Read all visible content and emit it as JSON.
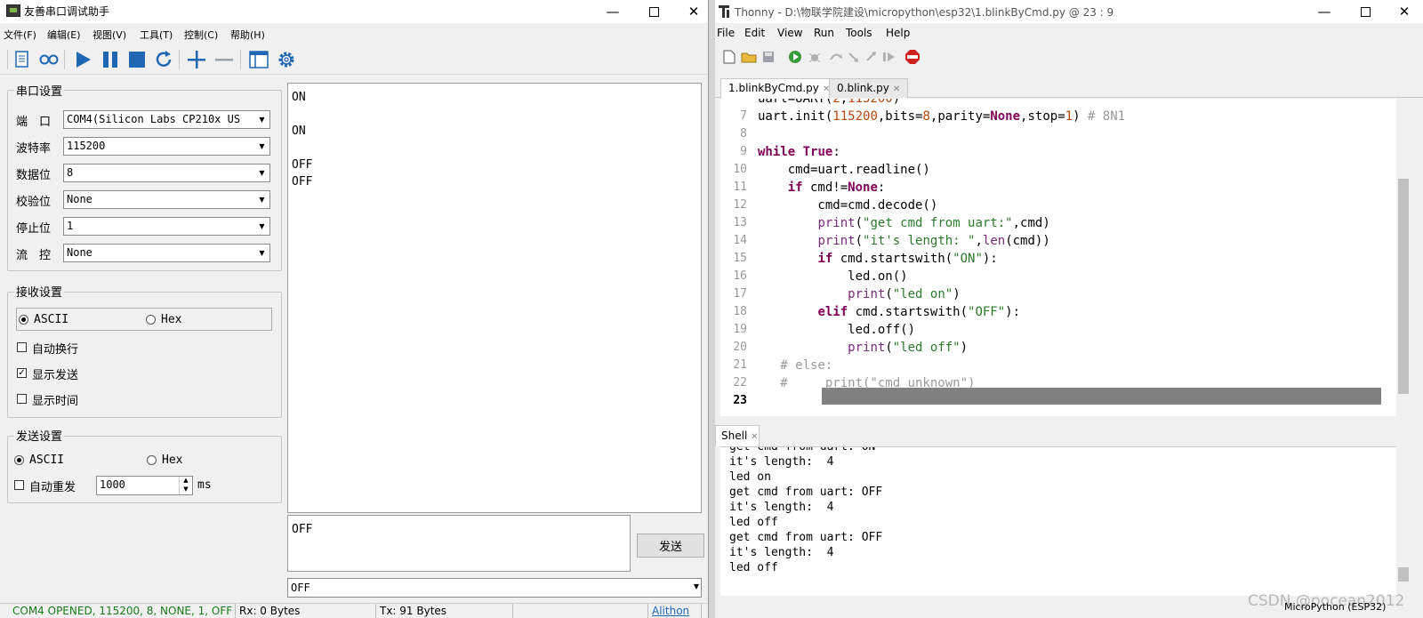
{
  "left_app": {
    "title": "友善串口调试助手",
    "menu": [
      "文件(F)",
      "编辑(E)",
      "视图(V)",
      "工具(T)",
      "控制(C)",
      "帮助(H)"
    ],
    "serial_settings": {
      "group_label": "串口设置",
      "fields": [
        {
          "label": "端　口",
          "value": "COM4(Silicon Labs CP210x US"
        },
        {
          "label": "波特率",
          "value": "115200"
        },
        {
          "label": "数据位",
          "value": "8"
        },
        {
          "label": "校验位",
          "value": "None"
        },
        {
          "label": "停止位",
          "value": "1"
        },
        {
          "label": "流　控",
          "value": "None"
        }
      ]
    },
    "receive_settings": {
      "group_label": "接收设置",
      "mode_ascii": "ASCII",
      "mode_hex": "Hex",
      "options": [
        {
          "label": "自动换行",
          "checked": false
        },
        {
          "label": "显示发送",
          "checked": true
        },
        {
          "label": "显示时间",
          "checked": false
        }
      ]
    },
    "send_settings": {
      "group_label": "发送设置",
      "mode_ascii": "ASCII",
      "mode_hex": "Hex",
      "auto_resend_label": "自动重发",
      "interval_value": "1000",
      "interval_unit": "ms"
    },
    "receive_text": [
      "ON",
      "",
      "ON",
      "",
      "OFF",
      "OFF"
    ],
    "send_text": "OFF",
    "send_button": "发送",
    "history_value": "OFF",
    "status": {
      "port": "COM4 OPENED, 115200, 8, NONE, 1, OFF",
      "rx": "Rx: 0 Bytes",
      "tx": "Tx: 91 Bytes",
      "link": "Alithon"
    }
  },
  "right_app": {
    "title": "Thonny  -  D:\\物联学院建设\\micropython\\esp32\\1.blinkByCmd.py  @  23 : 9",
    "menu": [
      "File",
      "Edit",
      "View",
      "Run",
      "Tools",
      "Help"
    ],
    "tabs": [
      {
        "label": "1.blinkByCmd.py",
        "active": true
      },
      {
        "label": "0.blink.py",
        "active": false
      }
    ],
    "line_numbers": [
      "7",
      "8",
      "9",
      "10",
      "11",
      "12",
      "13",
      "14",
      "15",
      "16",
      "17",
      "18",
      "19",
      "20",
      "21",
      "22",
      "23"
    ],
    "shell_tab": "Shell",
    "shell_lines": [
      "get cmd from uart: ON",
      "it's length:  4",
      "led on",
      "get cmd from uart: OFF",
      "it's length:  4",
      "led off",
      "get cmd from uart: OFF",
      "it's length:  4",
      "led off"
    ],
    "interpreter": "MicroPython (ESP32)"
  },
  "watermark": "CSDN @pocean2012"
}
